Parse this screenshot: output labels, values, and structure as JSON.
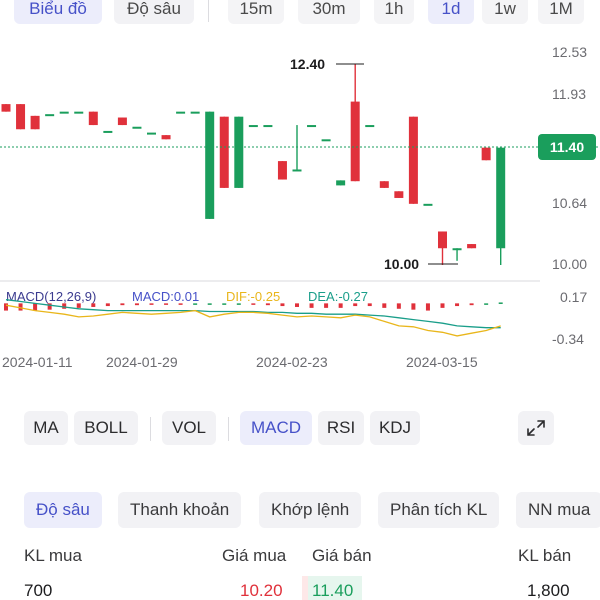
{
  "top_tabs": {
    "chart": "Biểu đồ",
    "depth": "Độ sâu",
    "intervals": [
      "15m",
      "30m",
      "1h",
      "1d",
      "1w",
      "1M"
    ],
    "active_interval": "1d"
  },
  "chart": {
    "price_axis": [
      "12.53",
      "11.93",
      "11.40",
      "10.64",
      "10.00"
    ],
    "current_price": "11.40",
    "high_label": "12.40",
    "low_label": "10.00",
    "colors": {
      "up": "#1a9e5c",
      "down": "#e0313b",
      "flat": "#1a9e5c",
      "current": "#1a9e5c",
      "dif": "#e9b61b",
      "dea": "#1a9e8a"
    },
    "macd_header": {
      "name": "MACD(12,26,9)",
      "macd": "MACD:0.01",
      "dif": "DIF:-0.25",
      "dea": "DEA:-0.27"
    },
    "macd_axis": [
      "0.17",
      "-0.34"
    ],
    "dates": [
      "2024-01-11",
      "2024-01-29",
      "2024-02-23",
      "2024-03-15"
    ]
  },
  "chart_data": {
    "type": "candlestick",
    "ylim": [
      10.0,
      12.53
    ],
    "candles": [
      {
        "o": 11.92,
        "c": 11.83,
        "h": 11.92,
        "l": 11.83
      },
      {
        "o": 11.92,
        "c": 11.62,
        "h": 11.92,
        "l": 11.62
      },
      {
        "o": 11.78,
        "c": 11.62,
        "h": 11.78,
        "l": 11.62
      },
      {
        "o": 11.8,
        "c": 11.8,
        "h": 11.8,
        "l": 11.8
      },
      {
        "o": 11.83,
        "c": 11.83,
        "h": 11.83,
        "l": 11.83
      },
      {
        "o": 11.83,
        "c": 11.83,
        "h": 11.83,
        "l": 11.83
      },
      {
        "o": 11.83,
        "c": 11.67,
        "h": 11.83,
        "l": 11.67
      },
      {
        "o": 11.6,
        "c": 11.6,
        "h": 11.6,
        "l": 11.6
      },
      {
        "o": 11.76,
        "c": 11.67,
        "h": 11.76,
        "l": 11.67
      },
      {
        "o": 11.65,
        "c": 11.65,
        "h": 11.65,
        "l": 11.65
      },
      {
        "o": 11.58,
        "c": 11.58,
        "h": 11.58,
        "l": 11.58
      },
      {
        "o": 11.55,
        "c": 11.5,
        "h": 11.55,
        "l": 11.5
      },
      {
        "o": 11.83,
        "c": 11.83,
        "h": 11.83,
        "l": 11.83
      },
      {
        "o": 11.83,
        "c": 11.83,
        "h": 11.83,
        "l": 11.83
      },
      {
        "o": 10.55,
        "c": 11.83,
        "h": 11.83,
        "l": 10.55
      },
      {
        "o": 11.77,
        "c": 10.92,
        "h": 11.77,
        "l": 10.92
      },
      {
        "o": 10.92,
        "c": 11.77,
        "h": 11.77,
        "l": 10.92
      },
      {
        "o": 11.67,
        "c": 11.67,
        "h": 11.67,
        "l": 11.67
      },
      {
        "o": 11.67,
        "c": 11.67,
        "h": 11.67,
        "l": 11.67
      },
      {
        "o": 11.24,
        "c": 11.02,
        "h": 11.24,
        "l": 11.02
      },
      {
        "o": 11.14,
        "c": 11.14,
        "h": 11.67,
        "l": 11.14
      },
      {
        "o": 11.67,
        "c": 11.67,
        "h": 11.67,
        "l": 11.67
      },
      {
        "o": 11.5,
        "c": 11.5,
        "h": 11.5,
        "l": 11.5
      },
      {
        "o": 10.95,
        "c": 11.01,
        "h": 11.01,
        "l": 10.95
      },
      {
        "o": 11.95,
        "c": 11.0,
        "h": 12.4,
        "l": 11.0
      },
      {
        "o": 11.67,
        "c": 11.67,
        "h": 11.67,
        "l": 11.67
      },
      {
        "o": 11.0,
        "c": 10.92,
        "h": 11.0,
        "l": 10.92
      },
      {
        "o": 10.88,
        "c": 10.8,
        "h": 10.88,
        "l": 10.8
      },
      {
        "o": 11.77,
        "c": 10.73,
        "h": 11.77,
        "l": 10.73
      },
      {
        "o": 10.73,
        "c": 10.73,
        "h": 10.73,
        "l": 10.73
      },
      {
        "o": 10.4,
        "c": 10.2,
        "h": 10.4,
        "l": 10.0
      },
      {
        "o": 10.2,
        "c": 10.2,
        "h": 10.2,
        "l": 10.05
      },
      {
        "o": 10.25,
        "c": 10.2,
        "h": 10.25,
        "l": 10.2
      },
      {
        "o": 11.4,
        "c": 11.25,
        "h": 11.4,
        "l": 11.25
      },
      {
        "o": 10.2,
        "c": 11.4,
        "h": 11.4,
        "l": 10.0
      }
    ],
    "macd_hist": [
      -0.08,
      -0.08,
      -0.08,
      -0.07,
      -0.06,
      -0.05,
      -0.04,
      -0.03,
      -0.02,
      -0.02,
      -0.01,
      -0.01,
      -0.01,
      0.0,
      0.0,
      0.0,
      0.0,
      -0.01,
      -0.02,
      -0.03,
      -0.04,
      -0.05,
      -0.05,
      -0.05,
      -0.03,
      -0.03,
      -0.05,
      -0.06,
      -0.07,
      -0.08,
      -0.05,
      -0.03,
      -0.02,
      0.0,
      0.01
    ],
    "dif": [
      -0.02,
      -0.05,
      -0.08,
      -0.1,
      -0.12,
      -0.15,
      -0.14,
      -0.12,
      -0.1,
      -0.11,
      -0.12,
      -0.11,
      -0.1,
      -0.08,
      -0.15,
      -0.12,
      -0.1,
      -0.1,
      -0.11,
      -0.13,
      -0.15,
      -0.14,
      -0.15,
      -0.16,
      -0.13,
      -0.15,
      -0.2,
      -0.25,
      -0.26,
      -0.3,
      -0.32,
      -0.36,
      -0.33,
      -0.3,
      -0.25
    ],
    "dea": [
      0.04,
      0.02,
      0.0,
      -0.02,
      -0.04,
      -0.06,
      -0.07,
      -0.08,
      -0.08,
      -0.08,
      -0.08,
      -0.08,
      -0.08,
      -0.08,
      -0.09,
      -0.09,
      -0.09,
      -0.09,
      -0.1,
      -0.1,
      -0.11,
      -0.11,
      -0.12,
      -0.12,
      -0.12,
      -0.13,
      -0.14,
      -0.16,
      -0.18,
      -0.2,
      -0.22,
      -0.25,
      -0.26,
      -0.27,
      -0.27
    ],
    "macd_ylim": [
      -0.45,
      0.17
    ]
  },
  "indicators": {
    "overlay": [
      "MA",
      "BOLL"
    ],
    "volume": [
      "VOL"
    ],
    "oscillators": [
      "MACD",
      "RSI",
      "KDJ"
    ],
    "active": "MACD"
  },
  "sub_tabs": [
    "Độ sâu",
    "Thanh khoản",
    "Khớp lệnh",
    "Phân tích KL",
    "NN mua"
  ],
  "orderbook": {
    "headers": {
      "bid_vol": "KL mua",
      "bid_price": "Giá mua",
      "ask_price": "Giá bán",
      "ask_vol": "KL bán"
    },
    "row": {
      "bid_vol": "700",
      "bid_price": "10.20",
      "ask_price": "11.40",
      "ask_vol": "1,800"
    }
  }
}
